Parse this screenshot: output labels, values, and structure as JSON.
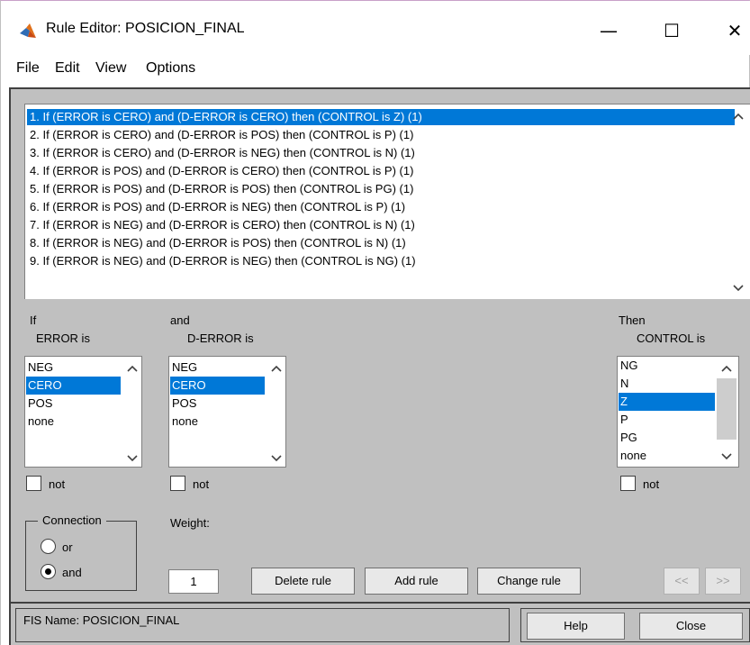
{
  "window": {
    "title": "Rule Editor: POSICION_FINAL",
    "minimize_glyph": "—",
    "maximize_glyph": "☐",
    "close_glyph": "✕"
  },
  "menu": [
    "File",
    "Edit",
    "View",
    "Options"
  ],
  "rules": [
    "1. If (ERROR is CERO) and (D-ERROR is CERO) then (CONTROL is Z) (1)",
    "2. If (ERROR is CERO) and (D-ERROR is POS) then (CONTROL is P) (1)",
    "3. If (ERROR is CERO) and (D-ERROR is NEG) then (CONTROL is N) (1)",
    "4. If (ERROR is POS) and (D-ERROR is CERO) then (CONTROL is P) (1)",
    "5. If (ERROR is POS) and (D-ERROR is POS) then (CONTROL is PG) (1)",
    "6. If (ERROR is POS) and (D-ERROR is NEG) then (CONTROL is P) (1)",
    "7. If (ERROR is NEG) and (D-ERROR is CERO) then (CONTROL is N) (1)",
    "8. If (ERROR is NEG) and (D-ERROR is POS) then (CONTROL is N) (1)",
    "9. If (ERROR is NEG) and (D-ERROR is NEG) then (CONTROL is NG) (1)"
  ],
  "selected_rule_index": 0,
  "if_panel": {
    "header": "If",
    "var_label": "ERROR is",
    "options": [
      "NEG",
      "CERO",
      "POS",
      "none"
    ],
    "selected": "CERO",
    "not_label": "not"
  },
  "and_panel": {
    "header": "and",
    "var_label": "D-ERROR is",
    "options": [
      "NEG",
      "CERO",
      "POS",
      "none"
    ],
    "selected": "CERO",
    "not_label": "not"
  },
  "then_panel": {
    "header": "Then",
    "var_label": "CONTROL is",
    "options": [
      "NG",
      "N",
      "Z",
      "P",
      "PG",
      "none"
    ],
    "selected": "Z",
    "not_label": "not"
  },
  "connection": {
    "legend": "Connection",
    "options": [
      "or",
      "and"
    ],
    "selected": "and"
  },
  "weight": {
    "label": "Weight:",
    "value": "1"
  },
  "buttons": {
    "delete": "Delete rule",
    "add": "Add rule",
    "change": "Change rule",
    "prev": "<<",
    "next": ">>",
    "help": "Help",
    "close": "Close"
  },
  "status": {
    "fis_name": "FIS Name: POSICION_FINAL"
  },
  "colors": {
    "selection": "#0078d7",
    "panel": "#c0c0c0"
  },
  "icons": {
    "app": "matlab-logo-icon",
    "scroll_up": "chevron-up-icon",
    "scroll_down": "chevron-down-icon"
  }
}
